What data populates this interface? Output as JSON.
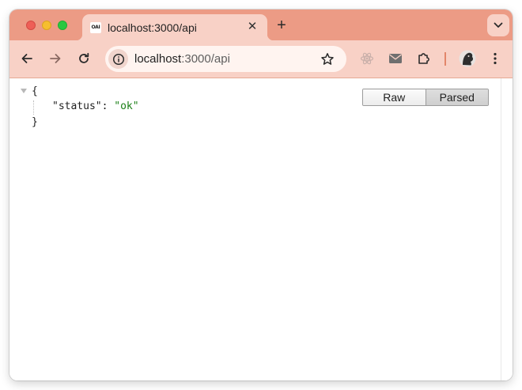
{
  "window": {
    "controls": [
      "close",
      "minimize",
      "maximize"
    ]
  },
  "tab": {
    "favicon_text": "OAI",
    "title": "localhost:3000/api",
    "close_glyph": "✕"
  },
  "new_tab_glyph": "+",
  "toolbar": {
    "url_host": "localhost",
    "url_path": ":3000/api",
    "extension_icons": [
      "react-devtools-icon",
      "mail-icon",
      "puzzle-extensions-icon"
    ],
    "profile": "avatar"
  },
  "json_viewer": {
    "open_brace": "{",
    "close_brace": "}",
    "entries": [
      {
        "key": "\"status\"",
        "separator": ": ",
        "value": "\"ok\""
      }
    ],
    "mode_buttons": [
      "Raw",
      "Parsed"
    ],
    "active_mode": "Parsed"
  },
  "colors": {
    "tabstrip": "#ec9b85",
    "toolbar": "#f8d1c6",
    "string_value": "#1a7f16"
  }
}
